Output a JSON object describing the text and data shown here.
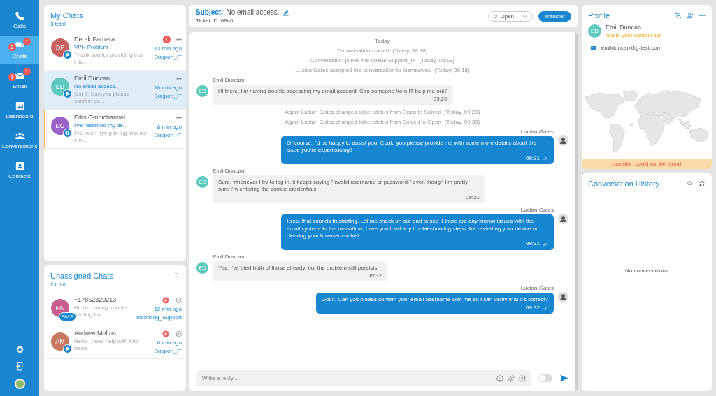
{
  "nav": {
    "items": [
      {
        "kind": "calls",
        "label": "Calls",
        "selected": false
      },
      {
        "kind": "chats",
        "label": "Chats",
        "selected": true,
        "badge": "1",
        "badge_2": "2"
      },
      {
        "kind": "email",
        "label": "Email",
        "selected": false,
        "badge": "1",
        "badge_2": "1"
      },
      {
        "kind": "dashboard",
        "label": "Dashboard",
        "selected": false
      },
      {
        "kind": "conversations",
        "label": "Conversations",
        "selected": false
      },
      {
        "kind": "contacts",
        "label": "Contacts",
        "selected": false
      }
    ]
  },
  "my_chats": {
    "title": "My Chats",
    "count": "3 total",
    "items": [
      {
        "initials": "DF",
        "color": "#c8605e",
        "kind": "chat",
        "name": "Derek Farnera",
        "subject": "VPN Problem",
        "preview": "Thank you for providing that info...",
        "time": "13 min ago",
        "queue": "Support_IT",
        "unread": "1",
        "selected": false,
        "flagged": false
      },
      {
        "initials": "ED",
        "color": "#5fc9be",
        "kind": "chat",
        "name": "Emil Duncan",
        "subject": "No email access.",
        "preview": "Got it. Can you please confirm yo...",
        "time": "16 min ago",
        "queue": "Support_IT",
        "selected": true,
        "flagged": false
      },
      {
        "initials": "EO",
        "color": "#9a62c8",
        "kind": "facebook",
        "name": "Edis Omnichannel",
        "subject": "I've restarted my de...",
        "preview": "I've been trying to log into my em...",
        "time": "8 min ago",
        "queue": "Support_IT",
        "selected": false,
        "flagged": true
      }
    ]
  },
  "unassigned": {
    "title": "Unassigned Chats",
    "count": "2 total",
    "items": [
      {
        "initials": "NN",
        "color": "#c85e8e",
        "kind": "sms",
        "channel_label": "SMS",
        "name": "+17862329213",
        "preview": "Hi, I'm having trouble printing fro...",
        "time": "12 min ago",
        "queue": "Incoming_Support"
      },
      {
        "initials": "AM",
        "color": "#c8785e",
        "kind": "chat",
        "name": "Andrew Melton",
        "preview": "Hello I need help with this issue",
        "time": "6 min ago",
        "queue": "Support_IT"
      }
    ]
  },
  "conversation": {
    "subject_label": "Subject:",
    "subject": "No email access.",
    "ticket": "Ticket ID: 6846",
    "status": "Open",
    "transfer": "Transfer",
    "messages": [
      {
        "kind": "day",
        "text": "Today"
      },
      {
        "kind": "system",
        "text": "Conversation started",
        "time": "(Today, 09:18)"
      },
      {
        "kind": "system",
        "text": "Conversation joined the queue Support_IT",
        "time": "(Today, 09:18)"
      },
      {
        "kind": "system",
        "text": "Lucian Gates assigned the conversation to themselves",
        "time": "(Today, 09:18)"
      },
      {
        "kind": "incoming",
        "author": "Emil Duncan",
        "initials": "ED",
        "text": "Hi there, I'm having trouble accessing my email account. Can someone from IT help me out?",
        "time": "09:20"
      },
      {
        "kind": "system",
        "text": "Agent Lucian Gates changed ticket status from Open to Solved",
        "time": "(Today, 09:29)"
      },
      {
        "kind": "system",
        "text": "Agent Lucian Gates changed ticket status from Solved to Open",
        "time": "(Today, 09:30)"
      },
      {
        "kind": "outgoing",
        "author": "Lucian Gates",
        "text": "Of course, I'd be happy to assist you. Could you please provide me with some more details about the issue you're experiencing?",
        "time": "09:31",
        "read": true
      },
      {
        "kind": "incoming",
        "author": "Emil Duncan",
        "initials": "ED",
        "text": "Sure, whenever I try to log in, it keeps saying \"Invalid username or password,\" even though I'm pretty sure I'm entering the correct credentials.",
        "time": "09:31"
      },
      {
        "kind": "outgoing",
        "author": "Lucian Gates",
        "text": "I see, that sounds frustrating. Let me check on our end to see if there are any known issues with the email system. In the meantime, have you tried any troubleshooting steps like restarting your device or clearing your browser cache?",
        "time": "09:31",
        "read": true
      },
      {
        "kind": "incoming",
        "author": "Emil Duncan",
        "initials": "ED",
        "text": "Yes, I've tried both of those already, but the problem still persists.",
        "time": "09:32"
      },
      {
        "kind": "outgoing",
        "author": "Lucian Gates",
        "text": "Got it. Can you please confirm your email username with me so I can verify that it's correct?",
        "time": "09:32",
        "read": true
      }
    ],
    "composer": {
      "placeholder": "Write a reply...",
      "toggle_on": false
    }
  },
  "profile": {
    "title": "Profile",
    "initials": "ED",
    "name": "Emil Duncan",
    "note": "Not in your contact list",
    "email": "emilduncan@g-test.com",
    "location_notice": "Location could not be found"
  },
  "history": {
    "title": "Conversation History",
    "empty": "No conversations"
  }
}
